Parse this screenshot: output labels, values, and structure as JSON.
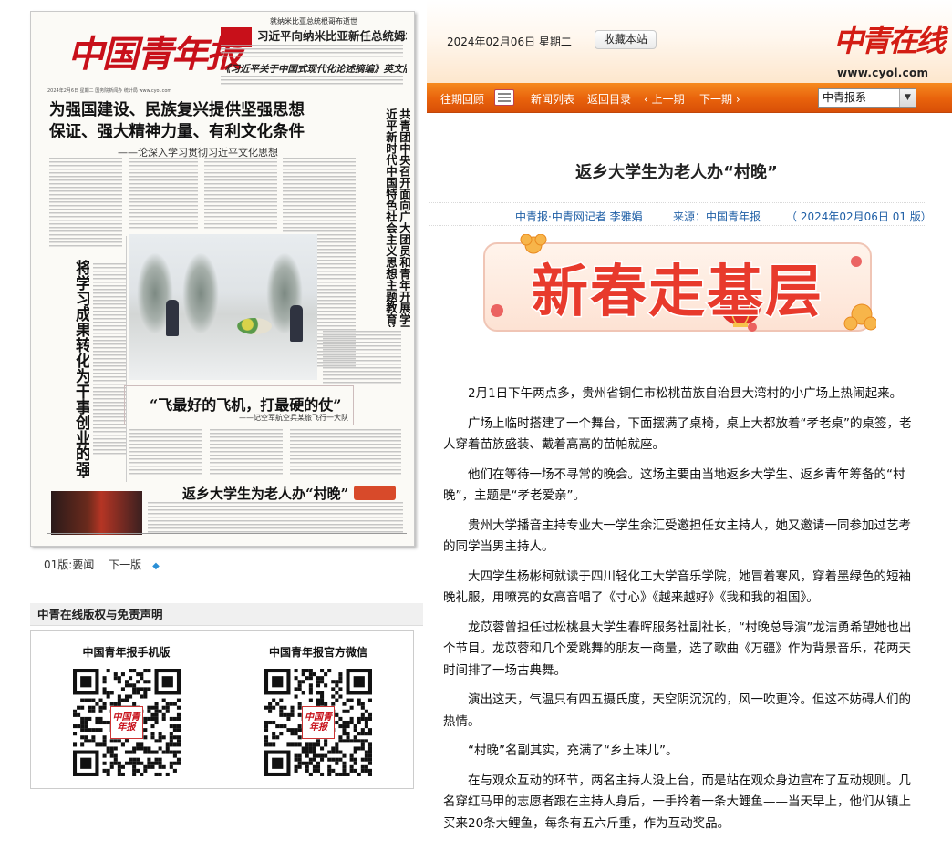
{
  "paper": {
    "masthead": "中国青年报",
    "top_small": "就纳米比亚总统根哥布逝世",
    "headline_1": "习近平向纳米比亚新任总统姆本巴致唁电",
    "headline_2": "《习近平关于中国式现代化论述摘编》英文版、俄汉对照版出版发行",
    "dateline": "2024年2月6日  星期二   国务院新闻办  统计局   www.cyol.com",
    "lead_title_1": "为强国建设、民族复兴提供坚强思想",
    "lead_title_2": "保证、强大精神力量、有利文化条件",
    "lead_sub": "——论深入学习贯彻习近平文化思想",
    "vertical_right": [
      "共青团中央召开面向广大团员和青年开展学习贯彻",
      "近平新时代中国特色社会主义思想主题教育总结会议"
    ],
    "vertical_left": [
      "将学习成果转化为干事创业的强大动力"
    ],
    "feature_title": "“飞最好的飞机，打最硬的仗”",
    "feature_sub": "——记空军航空兵某旅飞行一大队",
    "bottom_title": "返乡大学生为老人办“村晚”"
  },
  "paper_nav": {
    "page": "01版:要闻",
    "next": "下一版"
  },
  "disclaimer_title": "中青在线版权与免责声明",
  "qr": {
    "mobile_title": "中国青年报手机版",
    "wechat_title": "中国青年报官方微信",
    "logo_text": "中国青年报"
  },
  "header": {
    "date": "2024年02月06日 星期二",
    "bookmark": "收藏本站",
    "logo": "中青在线",
    "url": "www.cyol.com"
  },
  "nav": {
    "past": "往期回顾",
    "list": "新闻列表",
    "back": "返回目录",
    "prev": "上一期",
    "next": "下一期",
    "select_value": "中青报系",
    "prev_arrow": "‹",
    "next_arrow": "›"
  },
  "article": {
    "title": "返乡大学生为老人办“村晚”",
    "byline_author": "中青报·中青网记者  李雅娟",
    "byline_source": "来源：中国青年报",
    "byline_date": "（ 2024年02月06日   01 版）",
    "banner_text": "新春走基层",
    "paragraphs": [
      "2月1日下午两点多，贵州省铜仁市松桃苗族自治县大湾村的小广场上热闹起来。",
      "广场上临时搭建了一个舞台，下面摆满了桌椅，桌上大都放着“孝老桌”的桌签，老人穿着苗族盛装、戴着高高的苗帕就座。",
      "他们在等待一场不寻常的晚会。这场主要由当地返乡大学生、返乡青年筹备的“村晚”，主题是“孝老爱亲”。",
      "贵州大学播音主持专业大一学生余汇受邀担任女主持人，她又邀请一同参加过艺考的同学当男主持人。",
      "大四学生杨彬柯就读于四川轻化工大学音乐学院，她冒着寒风，穿着墨绿色的短袖晚礼服，用嘹亮的女高音唱了《寸心》《越来越好》《我和我的祖国》。",
      "龙苡蓉曾担任过松桃县大学生春晖服务社副社长，“村晚总导演”龙洁勇希望她也出个节目。龙苡蓉和几个爱跳舞的朋友一商量，选了歌曲《万疆》作为背景音乐，花两天时间排了一场古典舞。",
      "演出这天，气温只有四五摄氏度，天空阴沉沉的，风一吹更冷。但这不妨碍人们的热情。",
      "“村晚”名副其实，充满了“乡土味儿”。",
      "在与观众互动的环节，两名主持人没上台，而是站在观众身边宣布了互动规则。几名穿红马甲的志愿者跟在主持人身后，一手拎着一条大鲤鱼——当天早上，他们从镇上买来20条大鲤鱼，每条有五六斤重，作为互动奖品。"
    ]
  },
  "colors": {
    "nav_orange": "#e8620c",
    "brand_red": "#c8101a",
    "byline_blue": "#1f5fa6"
  }
}
